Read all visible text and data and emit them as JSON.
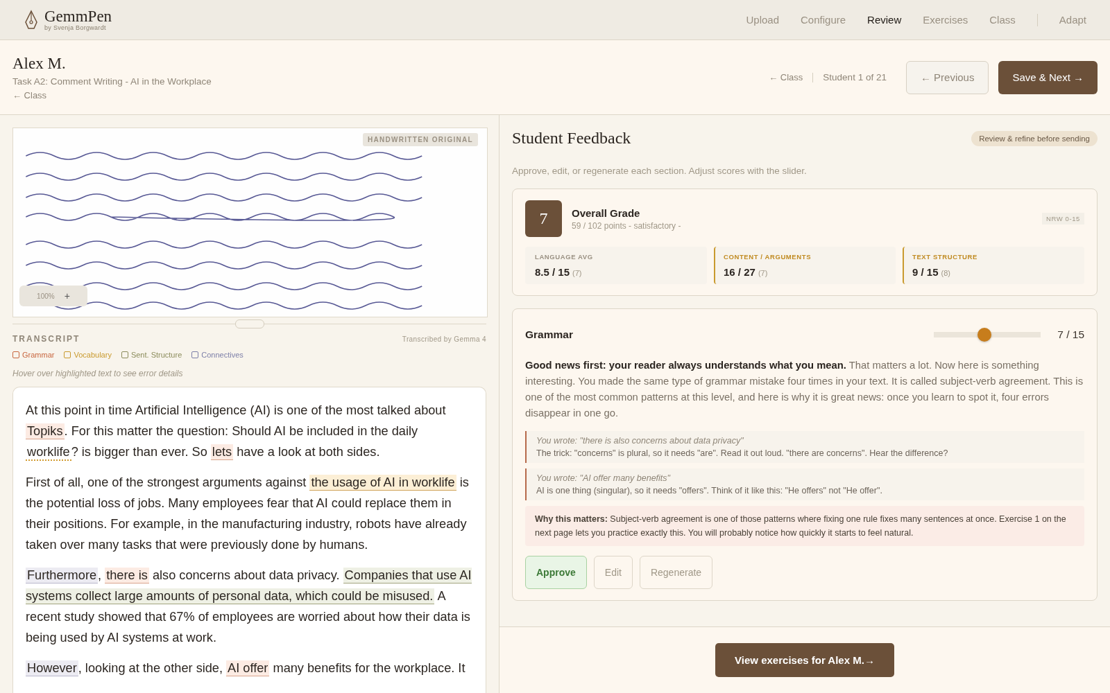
{
  "brand": {
    "name": "GemmPen",
    "byline": "by Svenja Borgwardt"
  },
  "nav": [
    {
      "label": "Upload",
      "selected": false
    },
    {
      "label": "Configure",
      "selected": false
    },
    {
      "label": "Review",
      "selected": true
    },
    {
      "label": "Exercises",
      "selected": false
    },
    {
      "label": "Class",
      "selected": false
    },
    {
      "label": "Adapt",
      "selected": false,
      "separated": true
    }
  ],
  "student": {
    "name": "Alex M.",
    "task": "Task A2: Comment Writing - AI in the Workplace",
    "back_link": "← Class"
  },
  "pager": {
    "back_link": "← Class",
    "position": "Student 1 of 21",
    "previous": "← Previous",
    "next": "Save & Next →"
  },
  "original": {
    "badge": "HANDWRITTEN ORIGINAL",
    "zoom": "100%",
    "zoom_in": "+"
  },
  "transcript": {
    "title": "TRANSCRIPT",
    "credit": "Transcribed by Gemma 4",
    "legend": [
      {
        "label": "Grammar",
        "color": "#c8663f",
        "checked": false
      },
      {
        "label": "Vocabulary",
        "color": "#c99a2e",
        "checked": false
      },
      {
        "label": "Sent. Structure",
        "color": "#8c8c5c",
        "checked": false
      },
      {
        "label": "Connectives",
        "color": "#7d7fa8",
        "checked": false
      }
    ],
    "hint": "Hover over highlighted text to see error details",
    "paragraphs": [
      [
        {
          "text": "At this point in time Artificial Intelligence (AI) is one of the most talked about "
        },
        {
          "text": "Topiks",
          "kind": "grammar"
        },
        {
          "text": ". For this matter the question: Should AI be included in the daily "
        },
        {
          "text": "worklife",
          "kind": "hint"
        },
        {
          "text": "? is bigger than ever. So "
        },
        {
          "text": "lets",
          "kind": "grammar"
        },
        {
          "text": " have a look at both sides."
        }
      ],
      [
        {
          "text": "First of all, one of the strongest arguments against "
        },
        {
          "text": "the usage of AI in worklife",
          "kind": "vocabulary"
        },
        {
          "text": " is the potential loss of jobs. Many employees fear that AI could replace them in their positions. For example, in the manufacturing industry, robots have already taken over many tasks that were previously done by humans."
        }
      ],
      [
        {
          "text": "Furthermore",
          "kind": "connective"
        },
        {
          "text": ", "
        },
        {
          "text": "there is",
          "kind": "grammar"
        },
        {
          "text": " also concerns about data privacy. "
        },
        {
          "text": "Companies that use AI systems collect large amounts of personal data, which could be misused.",
          "kind": "structure"
        },
        {
          "text": " A recent study showed that 67% of employees are worried about how their data is being used by AI systems at work."
        }
      ],
      [
        {
          "text": "However",
          "kind": "connective"
        },
        {
          "text": ", looking at the other side, "
        },
        {
          "text": "AI offer",
          "kind": "grammar"
        },
        {
          "text": " many benefits for the workplace. It"
        }
      ]
    ]
  },
  "feedback": {
    "title": "Student Feedback",
    "badge": "Review & refine before sending",
    "intro": "Approve, edit, or regenerate each section. Adjust scores with the slider.",
    "overall": {
      "grade": "7",
      "title": "Overall Grade",
      "points": "59 / 102 points - satisfactory -",
      "scale": "NRW 0-15",
      "scores": [
        {
          "label": "LANGUAGE AVG",
          "value": "8.5 / 15",
          "note": "(7)",
          "accent": false
        },
        {
          "label": "CONTENT / ARGUMENTS",
          "value": "16 / 27",
          "note": "(7)",
          "accent": true
        },
        {
          "label": "TEXT STRUCTURE",
          "value": "9 / 15",
          "note": "(8)",
          "accent": true
        }
      ]
    },
    "section": {
      "title": "Grammar",
      "level": 0.47,
      "score": "7 / 15",
      "body": "**Good news first: your reader always understands what you mean.** That matters a lot. Now here is something interesting. You made the same type of grammar mistake four times in your text. It is called subject-verb agreement. This is one of the most common patterns at this level, and here is why it is great news: once you learn to spot it, four errors disappear in one go.",
      "examples": [
        {
          "quote": "You wrote: \"there is also concerns about data privacy\"",
          "tip": "The trick: \"concerns\" is plural, so it needs \"are\". Read it out loud. \"there are concerns\". Hear the difference?"
        },
        {
          "quote": "You wrote: \"AI offer many benefits\"",
          "tip": "AI is one thing (singular), so it needs \"offers\". Think of it like this: \"He offers\" not \"He offer\"."
        }
      ],
      "why": "**Why this matters:** Subject-verb agreement is one of those patterns where fixing one rule fixes many sentences at once. Exercise 1 on the next page lets you practice exactly this. You will probably notice how quickly it starts to feel natural.",
      "actions": [
        {
          "label": "Approve",
          "kind": "approve"
        },
        {
          "label": "Edit",
          "kind": "plain"
        },
        {
          "label": "Regenerate",
          "kind": "plain"
        }
      ]
    },
    "footer_button": "View exercises for Alex M.→"
  }
}
